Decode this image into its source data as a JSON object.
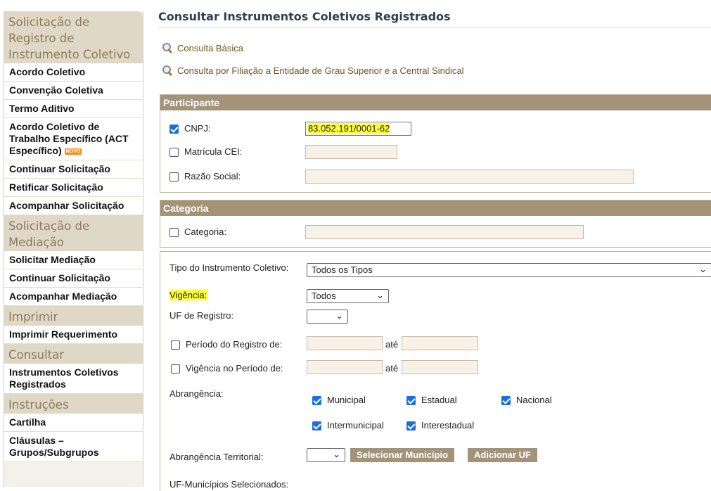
{
  "sidebar": {
    "sec1": "Solicitação de Registro de Instrumento Coletivo",
    "acordo": "Acordo Coletivo",
    "convencao": "Convenção Coletiva",
    "termo": "Termo Aditivo",
    "act": "Acordo Coletivo de Trabalho Específico (ACT Específico)",
    "novo": "NOVO",
    "continuar": "Continuar Solicitação",
    "retificar": "Retificar Solicitação",
    "acompanhar": "Acompanhar Solicitação",
    "sec2": "Solicitação de Mediação",
    "solicitar_mediacao": "Solicitar Mediação",
    "continuar2": "Continuar Solicitação",
    "acompanhar_mediacao": "Acompanhar Mediação",
    "sec3": "Imprimir",
    "imprimir_req": "Imprimir Requerimento",
    "sec4": "Consultar",
    "instrumentos": "Instrumentos Coletivos Registrados",
    "sec5": "Instruções",
    "cartilha": "Cartilha",
    "clausulas": "Cláusulas – Grupos/Subgrupos"
  },
  "main": {
    "title": "Consultar Instrumentos Coletivos Registrados",
    "link_basica": "Consulta Básica",
    "link_filiacao": "Consulta por Filiação a Entidade de Grau Superior e a Central Sindical",
    "participante": {
      "header": "Participante",
      "cnpj_label": "CNPJ:",
      "cnpj_value": "83.052.191/0001-62",
      "cei_label": "Matrícula CEI:",
      "razao_label": "Razão Social:"
    },
    "categoria": {
      "header": "Categoria",
      "label": "Categoria:"
    },
    "filtros": {
      "tipo_label": "Tipo do Instrumento Coletivo:",
      "tipo_value": "Todos os Tipos",
      "vigencia_label": "Vigência:",
      "vigencia_value": "Todos",
      "uf_label": "UF de Registro:",
      "periodo_registro_label": "Período do Registro de:",
      "ate": "até",
      "vigencia_periodo_label": "Vigência no Período de:",
      "abrangencia_label": "Abrangência:",
      "municipal": "Municipal",
      "estadual": "Estadual",
      "nacional": "Nacional",
      "intermunicipal": "Intermunicipal",
      "interestadual": "Interestadual",
      "territorial_label": "Abrangência Territorial:",
      "btn_municipio": "Selecionar Município",
      "btn_uf": "Adicionar UF",
      "uf_municipios_label": "UF-Municípios Selecionados:"
    }
  }
}
